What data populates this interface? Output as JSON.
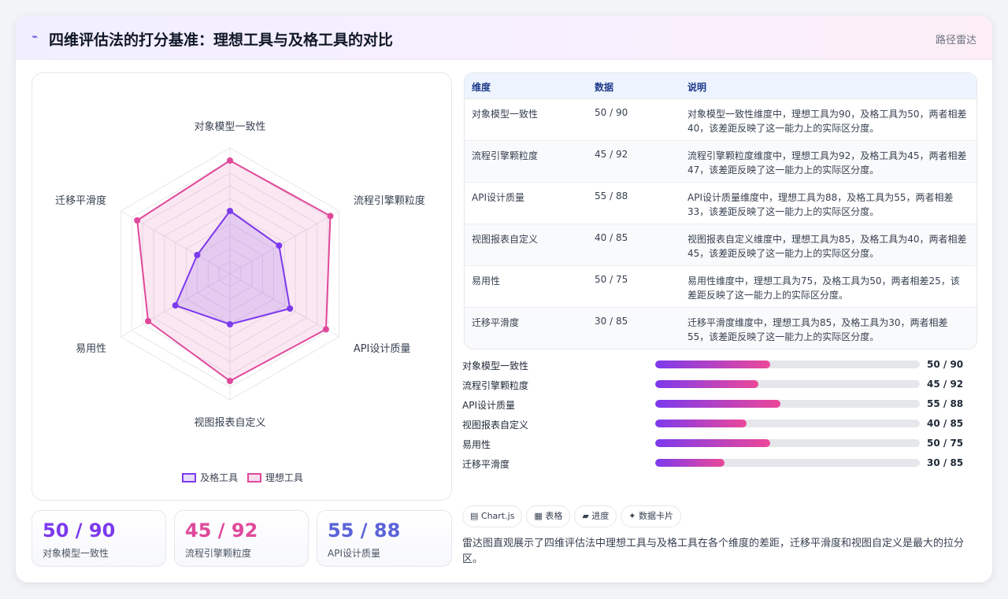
{
  "header": {
    "logo_icon": "trend-icon",
    "title": "四维评估法的打分基准：理想工具与及格工具的对比",
    "chart_type_label": "路径雷达"
  },
  "colors": {
    "passing": "#7c3aed",
    "ideal": "#e0499b",
    "stat_values": [
      "#7c3aed",
      "#e0499b",
      "#5b63d9"
    ]
  },
  "chart_data": {
    "type": "radar",
    "axes": [
      "对象模型一致性",
      "流程引擎颗粒度",
      "API设计质量",
      "视图报表自定义",
      "易用性",
      "迁移平滑度"
    ],
    "rlim": [
      0,
      100
    ],
    "grid_levels": 10,
    "series": [
      {
        "name": "及格工具",
        "values": [
          50,
          45,
          55,
          40,
          50,
          30
        ]
      },
      {
        "name": "理想工具",
        "values": [
          90,
          92,
          88,
          85,
          75,
          85
        ]
      }
    ],
    "legend": "bottom"
  },
  "stats": [
    {
      "value": "50 / 90",
      "label": "对象模型一致性"
    },
    {
      "value": "45 / 92",
      "label": "流程引擎颗粒度"
    },
    {
      "value": "55 / 88",
      "label": "API设计质量"
    }
  ],
  "table": {
    "headers": [
      "维度",
      "数据",
      "说明"
    ],
    "rows": [
      {
        "dim": "对象模型一致性",
        "data": "50 / 90",
        "note": "对象模型一致性维度中，理想工具为90，及格工具为50，两者相差40，该差距反映了这一能力上的实际区分度。"
      },
      {
        "dim": "流程引擎颗粒度",
        "data": "45 / 92",
        "note": "流程引擎颗粒度维度中，理想工具为92，及格工具为45，两者相差47，该差距反映了这一能力上的实际区分度。"
      },
      {
        "dim": "API设计质量",
        "data": "55 / 88",
        "note": "API设计质量维度中，理想工具为88，及格工具为55，两者相差33，该差距反映了这一能力上的实际区分度。"
      },
      {
        "dim": "视图报表自定义",
        "data": "40 / 85",
        "note": "视图报表自定义维度中，理想工具为85，及格工具为40，两者相差45，该差距反映了这一能力上的实际区分度。"
      },
      {
        "dim": "易用性",
        "data": "50 / 75",
        "note": "易用性维度中，理想工具为75，及格工具为50，两者相差25，该差距反映了这一能力上的实际区分度。"
      },
      {
        "dim": "迁移平滑度",
        "data": "30 / 85",
        "note": "迁移平滑度维度中，理想工具为85，及格工具为30，两者相差55，该差距反映了这一能力上的实际区分度。"
      }
    ]
  },
  "progress": [
    {
      "label": "对象模型一致性",
      "value": "50 / 90",
      "fraction": 0.4333
    },
    {
      "label": "流程引擎颗粒度",
      "value": "45 / 92",
      "fraction": 0.3889
    },
    {
      "label": "API设计质量",
      "value": "55 / 88",
      "fraction": 0.4722
    },
    {
      "label": "视图报表自定义",
      "value": "40 / 85",
      "fraction": 0.3444
    },
    {
      "label": "易用性",
      "value": "50 / 75",
      "fraction": 0.4333
    },
    {
      "label": "迁移平滑度",
      "value": "30 / 85",
      "fraction": 0.2611
    }
  ],
  "chips": [
    {
      "icon": "chart-icon",
      "glyph": "▤",
      "label": "Chart.js"
    },
    {
      "icon": "table-icon",
      "glyph": "▦",
      "label": "表格"
    },
    {
      "icon": "progress-icon",
      "glyph": "▰",
      "label": "进度"
    },
    {
      "icon": "card-icon",
      "glyph": "✦",
      "label": "数据卡片"
    }
  ],
  "summary": "雷达图直观展示了四维评估法中理想工具与及格工具在各个维度的差距，迁移平滑度和视图自定义是最大的拉分区。"
}
